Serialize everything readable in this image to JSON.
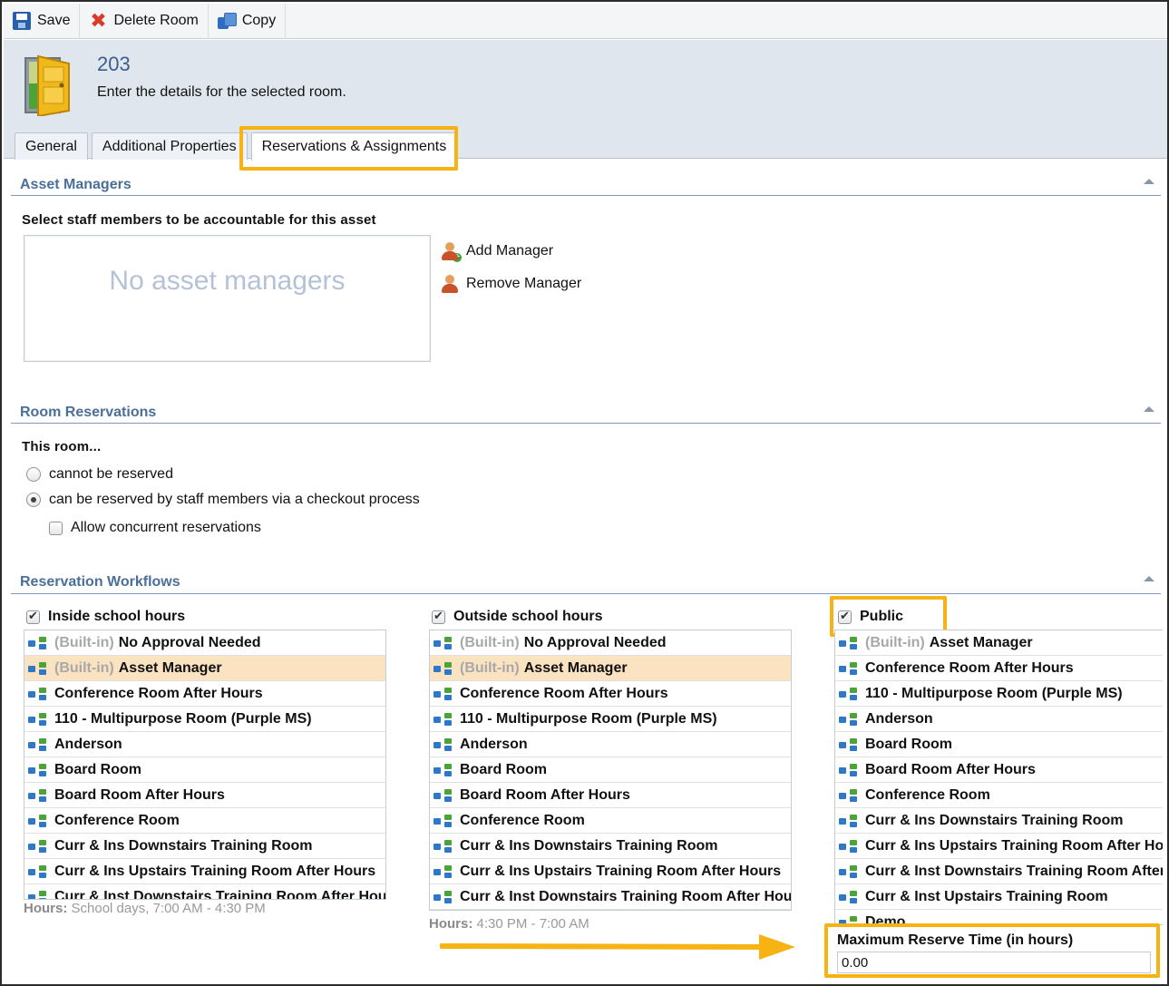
{
  "toolbar": {
    "save_label": "Save",
    "delete_label": "Delete Room",
    "copy_label": "Copy"
  },
  "header": {
    "title": "203",
    "description": "Enter the details for the selected room."
  },
  "tabs": [
    {
      "label": "General",
      "active": false
    },
    {
      "label": "Additional Properties",
      "active": false
    },
    {
      "label": "Reservations & Assignments",
      "active": true
    }
  ],
  "asset_managers": {
    "section_title": "Asset Managers",
    "instruction": "Select staff members to be accountable for this asset",
    "empty_text": "No asset managers",
    "add_label": "Add Manager",
    "remove_label": "Remove Manager"
  },
  "room_reservations": {
    "section_title": "Room Reservations",
    "intro": "This room...",
    "options": [
      {
        "label": "cannot be reserved",
        "selected": false
      },
      {
        "label": "can be reserved by staff members via a checkout process",
        "selected": true
      }
    ],
    "concurrent_label": "Allow concurrent reservations",
    "concurrent_checked": false
  },
  "workflows": {
    "section_title": "Reservation Workflows",
    "builtin_prefix": "(Built-in)",
    "columns": [
      {
        "title": "Inside school hours",
        "checked": true,
        "hours_label": "Hours:",
        "hours_value": "School days, 7:00 AM - 4:30 PM",
        "items": [
          {
            "label": "No Approval Needed",
            "builtin": true,
            "selected": false
          },
          {
            "label": "Asset Manager",
            "builtin": true,
            "selected": true
          },
          {
            "label": "Conference Room After Hours",
            "builtin": false,
            "selected": false
          },
          {
            "label": "110 - Multipurpose Room (Purple MS)",
            "builtin": false,
            "selected": false
          },
          {
            "label": "Anderson",
            "builtin": false,
            "selected": false
          },
          {
            "label": "Board Room",
            "builtin": false,
            "selected": false
          },
          {
            "label": "Board Room After Hours",
            "builtin": false,
            "selected": false
          },
          {
            "label": "Conference Room",
            "builtin": false,
            "selected": false
          },
          {
            "label": "Curr & Ins Downstairs Training Room",
            "builtin": false,
            "selected": false
          },
          {
            "label": "Curr & Ins Upstairs Training Room After Hours",
            "builtin": false,
            "selected": false
          },
          {
            "label": "Curr & Inst Downstairs Training Room After Hours",
            "builtin": false,
            "selected": false
          }
        ]
      },
      {
        "title": "Outside school hours",
        "checked": true,
        "hours_label": "Hours:",
        "hours_value": "4:30 PM - 7:00 AM",
        "items": [
          {
            "label": "No Approval Needed",
            "builtin": true,
            "selected": false
          },
          {
            "label": "Asset Manager",
            "builtin": true,
            "selected": true
          },
          {
            "label": "Conference Room After Hours",
            "builtin": false,
            "selected": false
          },
          {
            "label": "110 - Multipurpose Room (Purple MS)",
            "builtin": false,
            "selected": false
          },
          {
            "label": "Anderson",
            "builtin": false,
            "selected": false
          },
          {
            "label": "Board Room",
            "builtin": false,
            "selected": false
          },
          {
            "label": "Board Room After Hours",
            "builtin": false,
            "selected": false
          },
          {
            "label": "Conference Room",
            "builtin": false,
            "selected": false
          },
          {
            "label": "Curr & Ins Downstairs Training Room",
            "builtin": false,
            "selected": false
          },
          {
            "label": "Curr & Ins Upstairs Training Room After Hours",
            "builtin": false,
            "selected": false
          },
          {
            "label": "Curr & Inst Downstairs Training Room After Hours",
            "builtin": false,
            "selected": false
          }
        ]
      },
      {
        "title": "Public",
        "checked": true,
        "items": [
          {
            "label": "Asset Manager",
            "builtin": true,
            "selected": false
          },
          {
            "label": "Conference Room After Hours",
            "builtin": false,
            "selected": false
          },
          {
            "label": "110 - Multipurpose Room (Purple MS)",
            "builtin": false,
            "selected": false
          },
          {
            "label": "Anderson",
            "builtin": false,
            "selected": false
          },
          {
            "label": "Board Room",
            "builtin": false,
            "selected": false
          },
          {
            "label": "Board Room After Hours",
            "builtin": false,
            "selected": false
          },
          {
            "label": "Conference Room",
            "builtin": false,
            "selected": false
          },
          {
            "label": "Curr & Ins Downstairs Training Room",
            "builtin": false,
            "selected": false
          },
          {
            "label": "Curr & Ins Upstairs Training Room After Hours",
            "builtin": false,
            "selected": false
          },
          {
            "label": "Curr & Inst Downstairs Training Room After Hours",
            "builtin": false,
            "selected": false
          },
          {
            "label": "Curr & Inst Upstairs Training Room",
            "builtin": false,
            "selected": false
          },
          {
            "label": "Demo",
            "builtin": false,
            "selected": false
          }
        ]
      }
    ]
  },
  "max_reserve": {
    "label": "Maximum Reserve Time (in hours)",
    "value": "0.00"
  },
  "colors": {
    "highlight": "#f6b313",
    "section_title": "#4a6f98",
    "selected_row": "#fbe3c2"
  }
}
